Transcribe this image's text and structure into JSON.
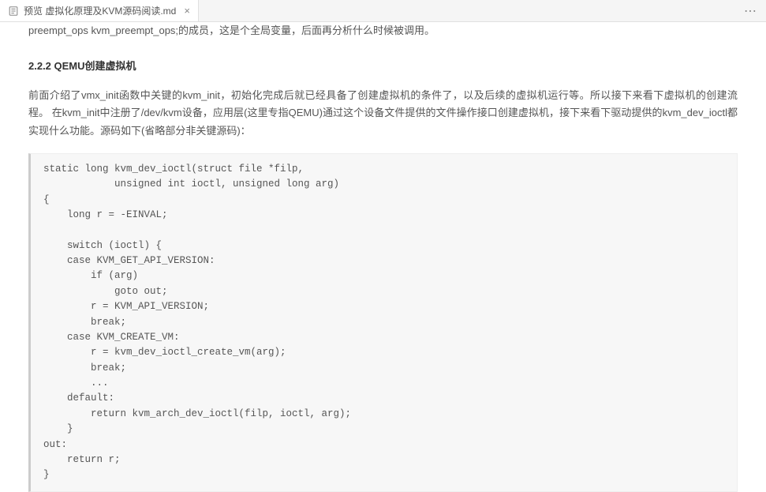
{
  "tab": {
    "title": "预览 虚拟化原理及KVM源码阅读.md"
  },
  "content": {
    "cutoff_text": "preempt_ops kvm_preempt_ops;的成员，这是个全局变量，后面再分析什么时候被调用。",
    "section_title": "2.2.2 QEMU创建虚拟机",
    "paragraph": "前面介绍了vmx_init函数中关键的kvm_init，初始化完成后就已经具备了创建虚拟机的条件了，以及后续的虚拟机运行等。所以接下来看下虚拟机的创建流程。 在kvm_init中注册了/dev/kvm设备，应用层(这里专指QEMU)通过这个设备文件提供的文件操作接口创建虚拟机，接下来看下驱动提供的kvm_dev_ioctl都实现什么功能。源码如下(省略部分非关键源码)：",
    "code": "static long kvm_dev_ioctl(struct file *filp,\n            unsigned int ioctl, unsigned long arg)\n{\n    long r = -EINVAL;\n\n    switch (ioctl) {\n    case KVM_GET_API_VERSION:\n        if (arg)\n            goto out;\n        r = KVM_API_VERSION;\n        break;\n    case KVM_CREATE_VM:\n        r = kvm_dev_ioctl_create_vm(arg);\n        break;\n        ...\n    default:\n        return kvm_arch_dev_ioctl(filp, ioctl, arg);\n    }\nout:\n    return r;\n}"
  }
}
